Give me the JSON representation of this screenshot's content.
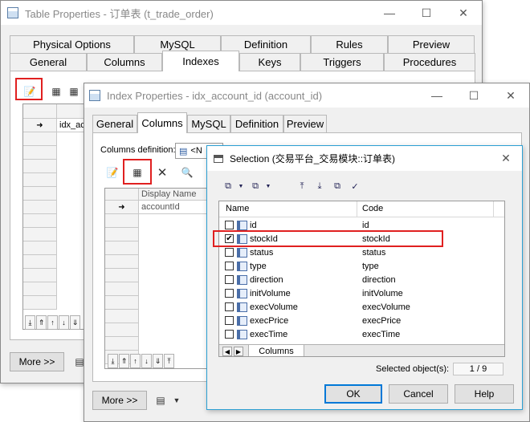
{
  "table_window": {
    "title": "Table Properties - 订单表 (t_trade_order)",
    "tabs_row1": [
      "Physical Options",
      "MySQL",
      "Definition",
      "Rules",
      "Preview"
    ],
    "tabs_row2": [
      "General",
      "Columns",
      "Indexes",
      "Keys",
      "Triggers",
      "Procedures"
    ],
    "selected_tab": "Indexes",
    "grid_row_value": "idx_ac",
    "more_button": "More >>"
  },
  "index_window": {
    "title": "Index Properties - idx_account_id (account_id)",
    "tabs": [
      "General",
      "Columns",
      "MySQL",
      "Definition",
      "Preview"
    ],
    "selected_tab": "Columns",
    "columns_definition_label": "Columns definition:",
    "columns_definition_value": "<N",
    "grid_header": "Display Name",
    "grid_row_value": "accountId",
    "more_button": "More >>"
  },
  "selection_dialog": {
    "title": "Selection (交易平台_交易模块::订单表)",
    "header_name": "Name",
    "header_code": "Code",
    "rows": [
      {
        "name": "id",
        "code": "id",
        "checked": false
      },
      {
        "name": "stockId",
        "code": "stockId",
        "checked": true
      },
      {
        "name": "status",
        "code": "status",
        "checked": false
      },
      {
        "name": "type",
        "code": "type",
        "checked": false
      },
      {
        "name": "direction",
        "code": "direction",
        "checked": false
      },
      {
        "name": "initVolume",
        "code": "initVolume",
        "checked": false
      },
      {
        "name": "execVolume",
        "code": "execVolume",
        "checked": false
      },
      {
        "name": "execPrice",
        "code": "execPrice",
        "checked": false
      },
      {
        "name": "execTime",
        "code": "execTime",
        "checked": false
      }
    ],
    "bottom_tab": "Columns",
    "selected_objects_label": "Selected object(s):",
    "selected_objects_value": "1 / 9",
    "ok_button": "OK",
    "cancel_button": "Cancel",
    "help_button": "Help"
  },
  "colors": {
    "highlight_red": "#e02020",
    "default_button_border": "#0078d7"
  }
}
